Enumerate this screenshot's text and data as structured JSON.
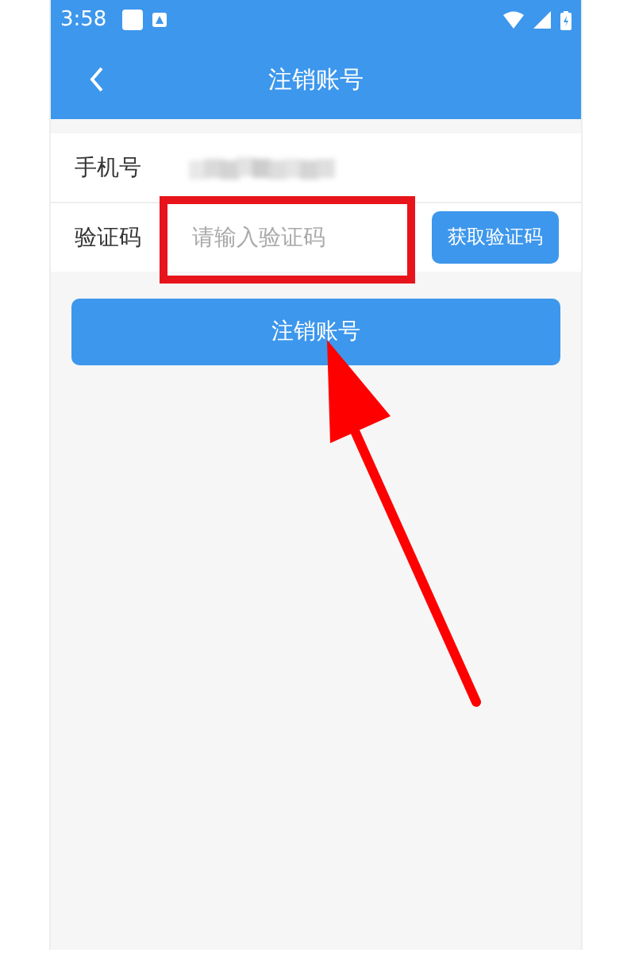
{
  "status_bar": {
    "time": "3:58"
  },
  "header": {
    "title": "注销账号"
  },
  "form": {
    "phone_label": "手机号",
    "code_label": "验证码",
    "code_placeholder": "请输入验证码",
    "get_code_button": "获取验证码"
  },
  "submit_button": "注销账号"
}
